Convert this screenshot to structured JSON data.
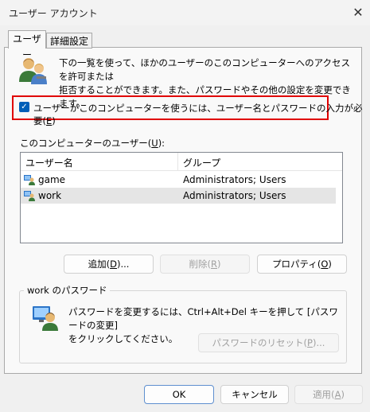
{
  "window": {
    "title": "ユーザー アカウント",
    "close_glyph": "✕"
  },
  "tabs": [
    {
      "label": "ユーザー"
    },
    {
      "label": "詳細設定"
    }
  ],
  "description": {
    "line1": "下の一覧を使って、ほかのユーザーのこのコンピューターへのアクセスを許可または",
    "line2": "拒否することができます。また、パスワードやその他の設定を変更できます。"
  },
  "require_password": {
    "checked": true,
    "check_glyph": "✓",
    "label_prefix": "ユーザーがこのコンピューターを使うには、ユーザー名とパスワードの入力が必要(",
    "accesskey": "E",
    "label_suffix": ")"
  },
  "users_section": {
    "label_prefix": "このコンピューターのユーザー(",
    "accesskey": "U",
    "label_suffix": "):"
  },
  "table": {
    "columns": [
      "ユーザー名",
      "グループ"
    ],
    "rows": [
      {
        "name": "game",
        "group": "Administrators; Users",
        "selected": false
      },
      {
        "name": "work",
        "group": "Administrators; Users",
        "selected": true
      }
    ]
  },
  "buttons": {
    "add": {
      "prefix": "追加(",
      "key": "D",
      "suffix": ")..."
    },
    "remove": {
      "prefix": "削除(",
      "key": "R",
      "suffix": ")"
    },
    "properties": {
      "prefix": "プロパティ(",
      "key": "O",
      "suffix": ")"
    }
  },
  "password_group": {
    "legend": "work のパスワード",
    "line1": "パスワードを変更するには、Ctrl+Alt+Del キーを押して [パスワードの変更]",
    "line2": "をクリックしてください。",
    "reset": {
      "prefix": "パスワードのリセット(",
      "key": "P",
      "suffix": ")..."
    }
  },
  "footer": {
    "ok": "OK",
    "cancel": "キャンセル",
    "apply": {
      "prefix": "適用(",
      "key": "A",
      "suffix": ")"
    }
  },
  "colors": {
    "accent": "#005fb8",
    "highlight_border": "#e00000"
  }
}
